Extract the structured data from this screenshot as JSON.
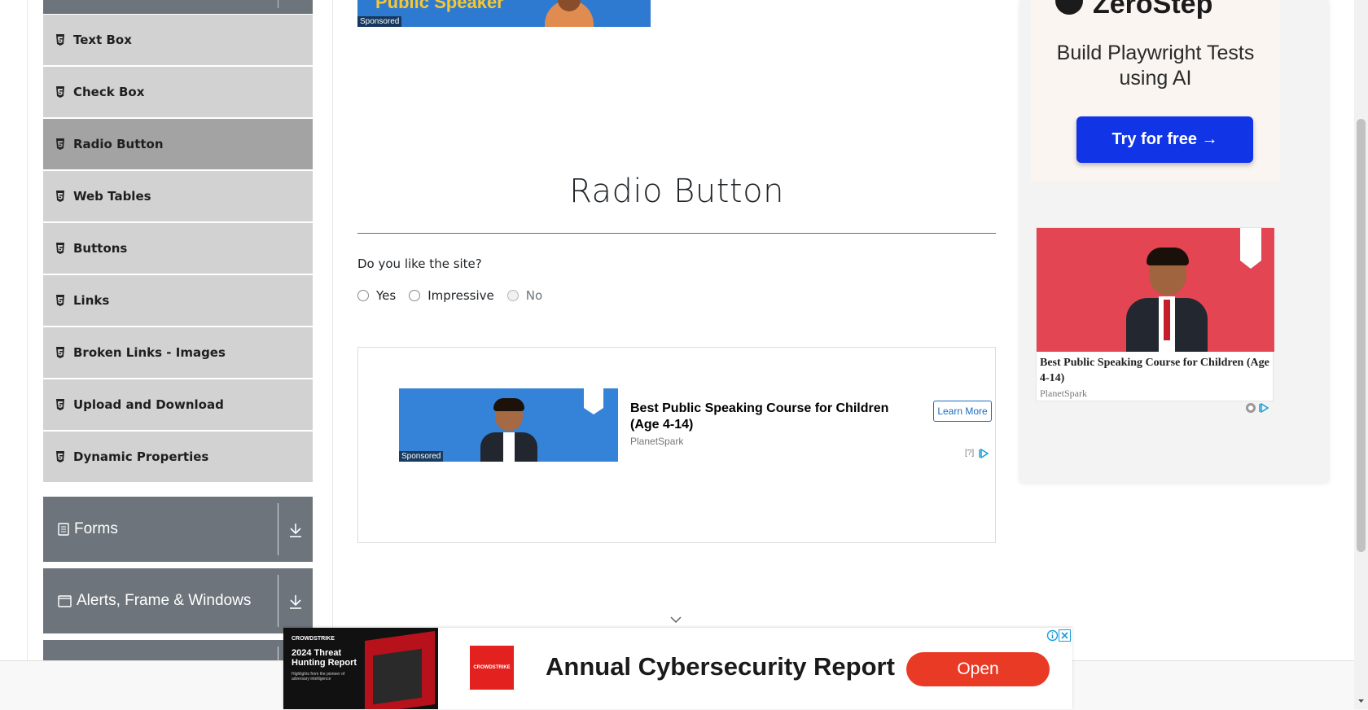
{
  "sidebar": {
    "items": [
      {
        "label": "Text Box",
        "active": false
      },
      {
        "label": "Check Box",
        "active": false
      },
      {
        "label": "Radio Button",
        "active": true
      },
      {
        "label": "Web Tables",
        "active": false
      },
      {
        "label": "Buttons",
        "active": false
      },
      {
        "label": "Links",
        "active": false
      },
      {
        "label": "Broken Links - Images",
        "active": false
      },
      {
        "label": "Upload and Download",
        "active": false
      },
      {
        "label": "Dynamic Properties",
        "active": false
      }
    ],
    "groups": [
      {
        "label": "Forms",
        "icon": "document-icon"
      },
      {
        "label": "Alerts, Frame & Windows",
        "icon": "window-icon"
      }
    ]
  },
  "top_banner": {
    "text": "Public Speaker",
    "sponsored": "Sponsored"
  },
  "main": {
    "title": "Radio Button",
    "question": "Do you like the site?",
    "options": [
      {
        "label": "Yes",
        "disabled": false,
        "checked": false
      },
      {
        "label": "Impressive",
        "disabled": false,
        "checked": false
      },
      {
        "label": "No",
        "disabled": true,
        "checked": false
      }
    ]
  },
  "inline_ad": {
    "sponsored": "Sponsored",
    "headline": "Best Public Speaking Course for Children (Age 4-14)",
    "brand": "PlanetSpark",
    "button": "Learn More",
    "info": "[?]"
  },
  "right_ad": {
    "logo": "ZeroStep",
    "headline": "Build Playwright Tests using AI",
    "button": "Try for free →",
    "card_text": "Best Public Speaking Course for Children (Age 4-14)",
    "card_brand": "PlanetSpark"
  },
  "bottom_ad": {
    "image_brand": "CROWDSTRIKE",
    "image_title": "2024 Threat Hunting Report",
    "image_sub": "Highlights from the pioneer of adversary intelligence",
    "logo_text": "CROWDSTRIKE",
    "headline": "Annual Cybersecurity Report",
    "button": "Open"
  },
  "colors": {
    "menu_item_bg": "#d2d2d2",
    "menu_item_active_bg": "#a3a3a3",
    "group_bg": "#6d747b",
    "ad_blue": "#1034e6",
    "open_btn": "#e93a26"
  }
}
